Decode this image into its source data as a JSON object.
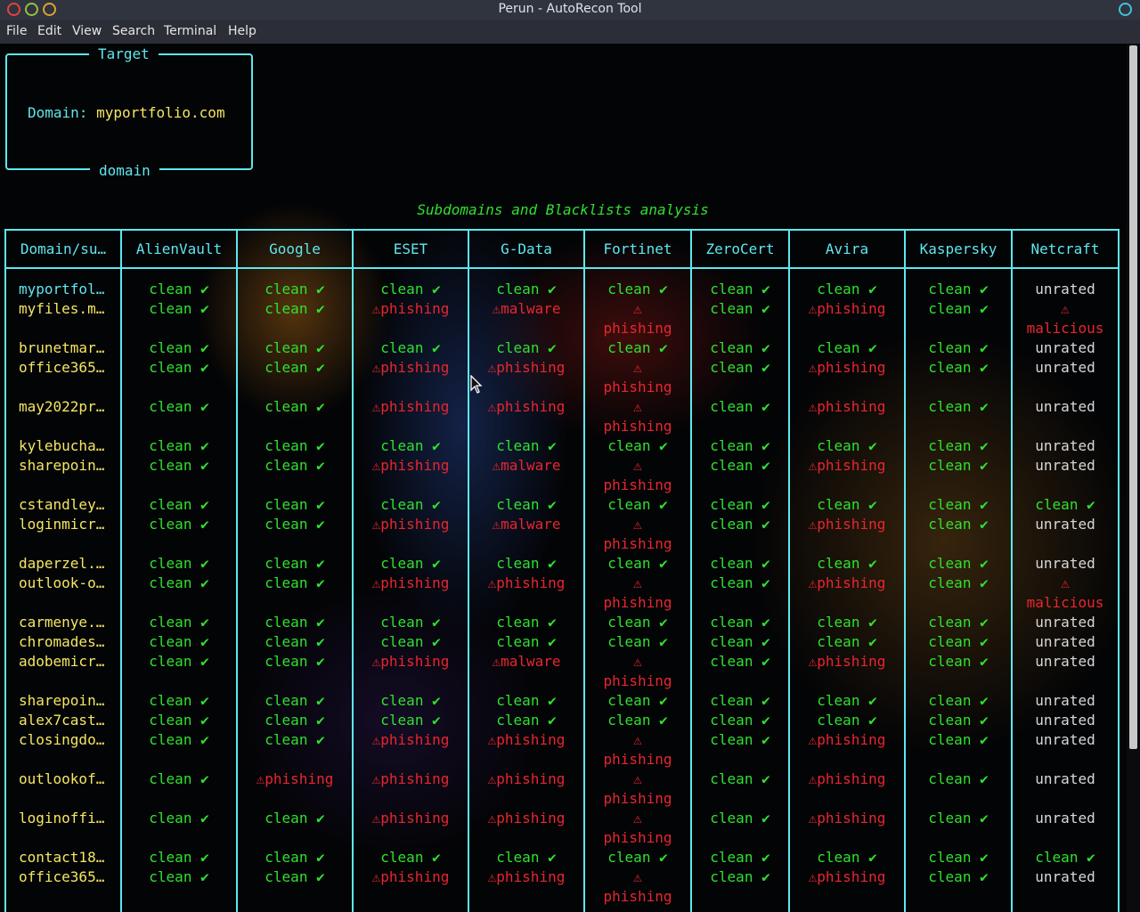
{
  "window": {
    "title": "Perun - AutoRecon Tool"
  },
  "menu": [
    "File",
    "Edit",
    "View",
    "Search",
    "Terminal",
    "Help"
  ],
  "target_box": {
    "title": "Target",
    "label": "Domain:",
    "value": "myportfolio.com",
    "footer": "domain"
  },
  "analysis": {
    "title": "Subdomains and Blacklists analysis",
    "headers": [
      "Domain/su…",
      "AlienVault",
      "Google",
      "ESET",
      "G-Data",
      "Fortinet",
      "ZeroCert",
      "Avira",
      "Kaspersky",
      "Netcraft"
    ],
    "status_text": {
      "clean": "clean ✔",
      "unrated": "unrated"
    },
    "colors": {
      "border": "#5fe7ee",
      "title": "#30e030",
      "clean": "#30e030",
      "threat": "#e8262f",
      "unrated": "#d8d8d8",
      "root_domain": "#5fe7ee",
      "subdomain": "#f5e663"
    },
    "rows": [
      {
        "domain": "myportfol…",
        "results": [
          "clean",
          "clean",
          "clean",
          "clean",
          "clean",
          "clean",
          "clean",
          "clean",
          "unrated"
        ]
      },
      {
        "domain": "myfiles.m…",
        "results": [
          "clean",
          "clean",
          "⚠phishing",
          "⚠malware",
          "⚠ phishing",
          "clean",
          "⚠phishing",
          "clean",
          "⚠ malicious"
        ]
      },
      {
        "domain": "brunetmar…",
        "results": [
          "clean",
          "clean",
          "clean",
          "clean",
          "clean",
          "clean",
          "clean",
          "clean",
          "unrated"
        ]
      },
      {
        "domain": "office365…",
        "results": [
          "clean",
          "clean",
          "⚠phishing",
          "⚠phishing",
          "⚠ phishing",
          "clean",
          "⚠phishing",
          "clean",
          "unrated"
        ]
      },
      {
        "domain": "may2022pr…",
        "results": [
          "clean",
          "clean",
          "⚠phishing",
          "⚠phishing",
          "⚠ phishing",
          "clean",
          "⚠phishing",
          "clean",
          "unrated"
        ]
      },
      {
        "domain": "kylebucha…",
        "results": [
          "clean",
          "clean",
          "clean",
          "clean",
          "clean",
          "clean",
          "clean",
          "clean",
          "unrated"
        ]
      },
      {
        "domain": "sharepoin…",
        "results": [
          "clean",
          "clean",
          "⚠phishing",
          "⚠malware",
          "⚠ phishing",
          "clean",
          "⚠phishing",
          "clean",
          "unrated"
        ]
      },
      {
        "domain": "cstandley…",
        "results": [
          "clean",
          "clean",
          "clean",
          "clean",
          "clean",
          "clean",
          "clean",
          "clean",
          "clean"
        ]
      },
      {
        "domain": "loginmicr…",
        "results": [
          "clean",
          "clean",
          "⚠phishing",
          "⚠malware",
          "⚠ phishing",
          "clean",
          "⚠phishing",
          "clean",
          "unrated"
        ]
      },
      {
        "domain": "daperzel.…",
        "results": [
          "clean",
          "clean",
          "clean",
          "clean",
          "clean",
          "clean",
          "clean",
          "clean",
          "unrated"
        ]
      },
      {
        "domain": "outlook-o…",
        "results": [
          "clean",
          "clean",
          "⚠phishing",
          "⚠phishing",
          "⚠ phishing",
          "clean",
          "⚠phishing",
          "clean",
          "⚠ malicious"
        ]
      },
      {
        "domain": "carmenye.…",
        "results": [
          "clean",
          "clean",
          "clean",
          "clean",
          "clean",
          "clean",
          "clean",
          "clean",
          "unrated"
        ]
      },
      {
        "domain": "chromades…",
        "results": [
          "clean",
          "clean",
          "clean",
          "clean",
          "clean",
          "clean",
          "clean",
          "clean",
          "unrated"
        ]
      },
      {
        "domain": "adobemicr…",
        "results": [
          "clean",
          "clean",
          "⚠phishing",
          "⚠malware",
          "⚠ phishing",
          "clean",
          "⚠phishing",
          "clean",
          "unrated"
        ]
      },
      {
        "domain": "sharepoin…",
        "results": [
          "clean",
          "clean",
          "clean",
          "clean",
          "clean",
          "clean",
          "clean",
          "clean",
          "unrated"
        ]
      },
      {
        "domain": "alex7cast…",
        "results": [
          "clean",
          "clean",
          "clean",
          "clean",
          "clean",
          "clean",
          "clean",
          "clean",
          "unrated"
        ]
      },
      {
        "domain": "closingdo…",
        "results": [
          "clean",
          "clean",
          "⚠phishing",
          "⚠phishing",
          "⚠ phishing",
          "clean",
          "⚠phishing",
          "clean",
          "unrated"
        ]
      },
      {
        "domain": "outlookof…",
        "results": [
          "clean",
          "⚠phishing",
          "⚠phishing",
          "⚠phishing",
          "⚠ phishing",
          "clean",
          "⚠phishing",
          "clean",
          "unrated"
        ]
      },
      {
        "domain": "loginoffi…",
        "results": [
          "clean",
          "clean",
          "⚠phishing",
          "⚠phishing",
          "⚠ phishing",
          "clean",
          "⚠phishing",
          "clean",
          "unrated"
        ]
      },
      {
        "domain": "contact18…",
        "results": [
          "clean",
          "clean",
          "clean",
          "clean",
          "clean",
          "clean",
          "clean",
          "clean",
          "clean"
        ]
      },
      {
        "domain": "office365…",
        "results": [
          "clean",
          "clean",
          "⚠phishing",
          "⚠phishing",
          "⚠ phishing",
          "clean",
          "⚠phishing",
          "clean",
          "unrated"
        ]
      }
    ]
  }
}
